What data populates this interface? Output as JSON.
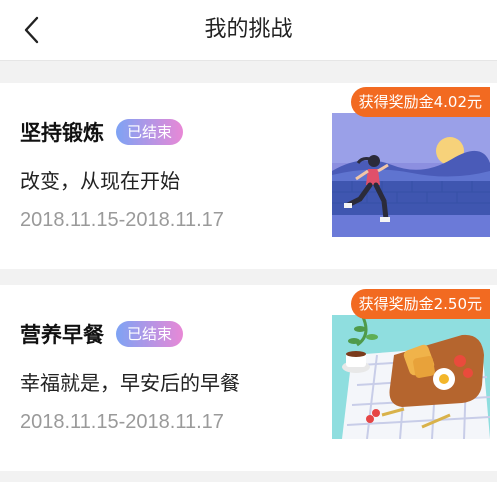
{
  "header": {
    "title": "我的挑战"
  },
  "challenges": [
    {
      "name": "坚持锻炼",
      "status": "已结束",
      "slogan": "改变，从现在开始",
      "dates": "2018.11.15-2018.11.17",
      "reward": "获得奖励金4.02元"
    },
    {
      "name": "营养早餐",
      "status": "已结束",
      "slogan": "幸福就是，早安后的早餐",
      "dates": "2018.11.15-2018.11.17",
      "reward": "获得奖励金2.50元"
    }
  ],
  "colors": {
    "accent": "#f26a21",
    "badge_start": "#7ea3f4",
    "badge_end": "#e888d6"
  }
}
